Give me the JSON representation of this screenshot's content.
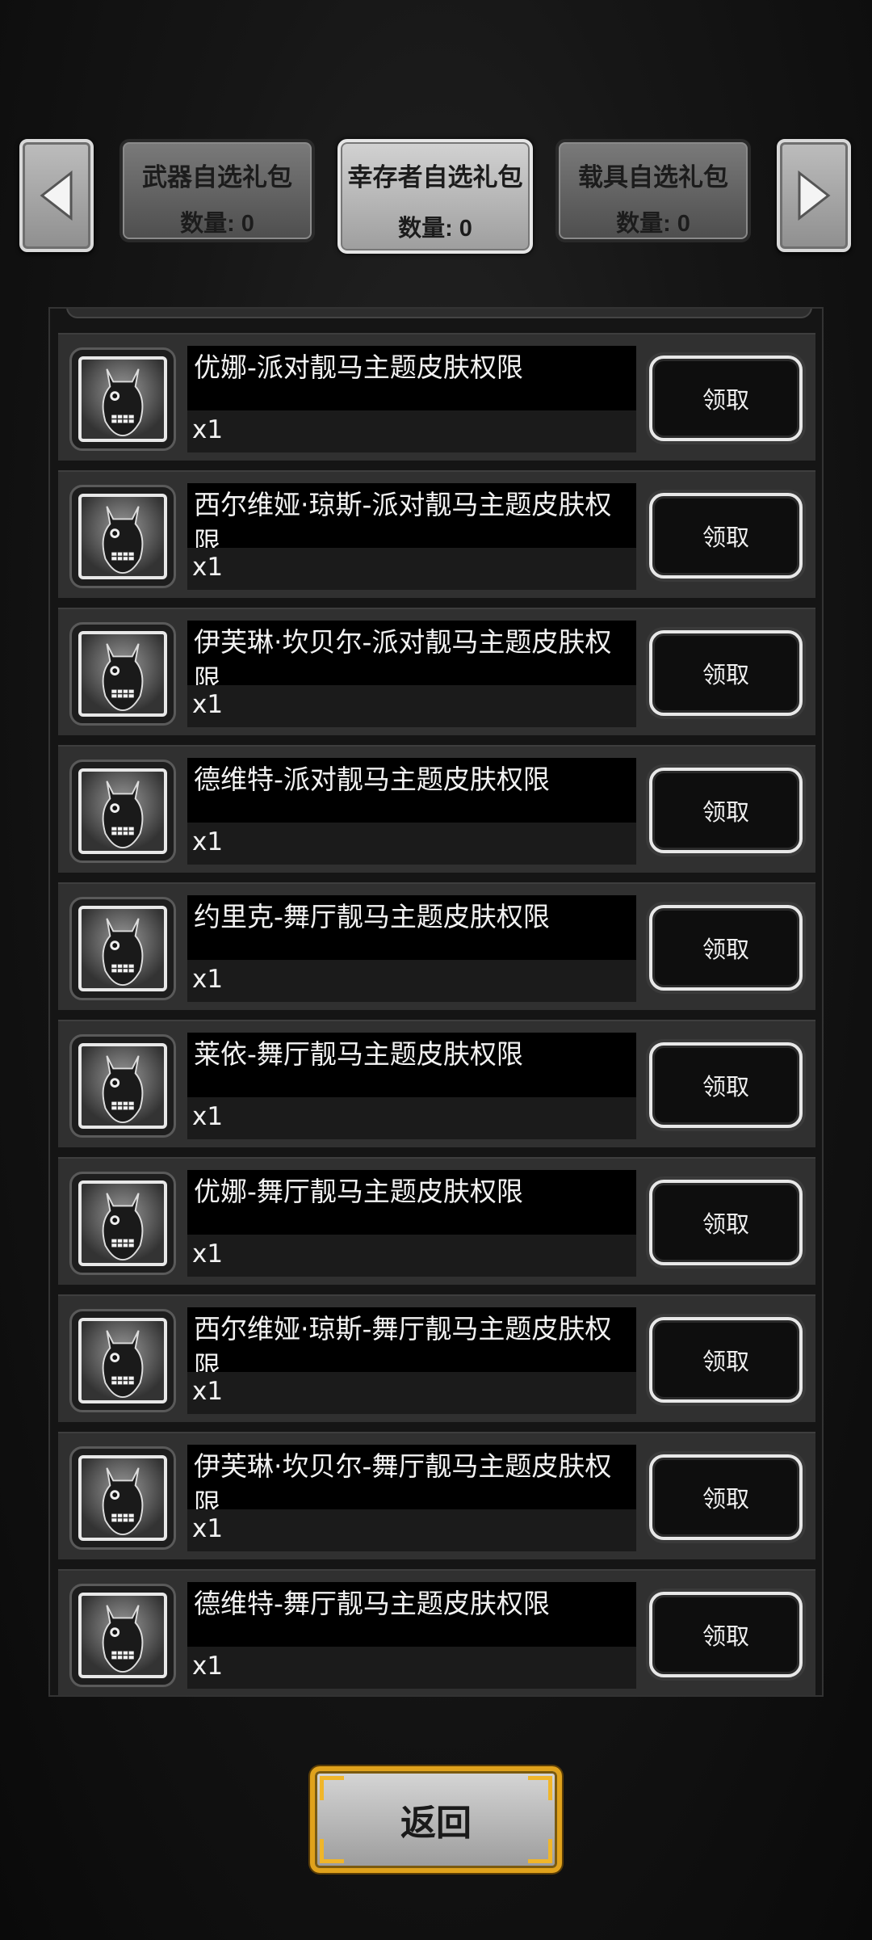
{
  "tabs": [
    {
      "label": "武器自选礼包",
      "count": "数量: 0",
      "active": false
    },
    {
      "label": "幸存者自选礼包",
      "count": "数量: 0",
      "active": true
    },
    {
      "label": "载具自选礼包",
      "count": "数量: 0",
      "active": false
    }
  ],
  "nav": {
    "prev_icon": "arrow-left-icon",
    "next_icon": "arrow-right-icon"
  },
  "items": [
    {
      "name": "优娜-派对靓马主题皮肤权限",
      "qty": "x1",
      "button": "领取"
    },
    {
      "name": "西尔维娅·琼斯-派对靓马主题皮肤权限",
      "qty": "x1",
      "button": "领取"
    },
    {
      "name": "伊芙琳·坎贝尔-派对靓马主题皮肤权限",
      "qty": "x1",
      "button": "领取"
    },
    {
      "name": "德维特-派对靓马主题皮肤权限",
      "qty": "x1",
      "button": "领取"
    },
    {
      "name": "约里克-舞厅靓马主题皮肤权限",
      "qty": "x1",
      "button": "领取"
    },
    {
      "name": "莱依-舞厅靓马主题皮肤权限",
      "qty": "x1",
      "button": "领取"
    },
    {
      "name": "优娜-舞厅靓马主题皮肤权限",
      "qty": "x1",
      "button": "领取"
    },
    {
      "name": "西尔维娅·琼斯-舞厅靓马主题皮肤权限",
      "qty": "x1",
      "button": "领取"
    },
    {
      "name": "伊芙琳·坎贝尔-舞厅靓马主题皮肤权限",
      "qty": "x1",
      "button": "领取"
    },
    {
      "name": "德维特-舞厅靓马主题皮肤权限",
      "qty": "x1",
      "button": "领取"
    }
  ],
  "footer": {
    "back_label": "返回"
  },
  "colors": {
    "accent_gold": "#e0a21c",
    "claim_border": "#e8e8e8"
  }
}
